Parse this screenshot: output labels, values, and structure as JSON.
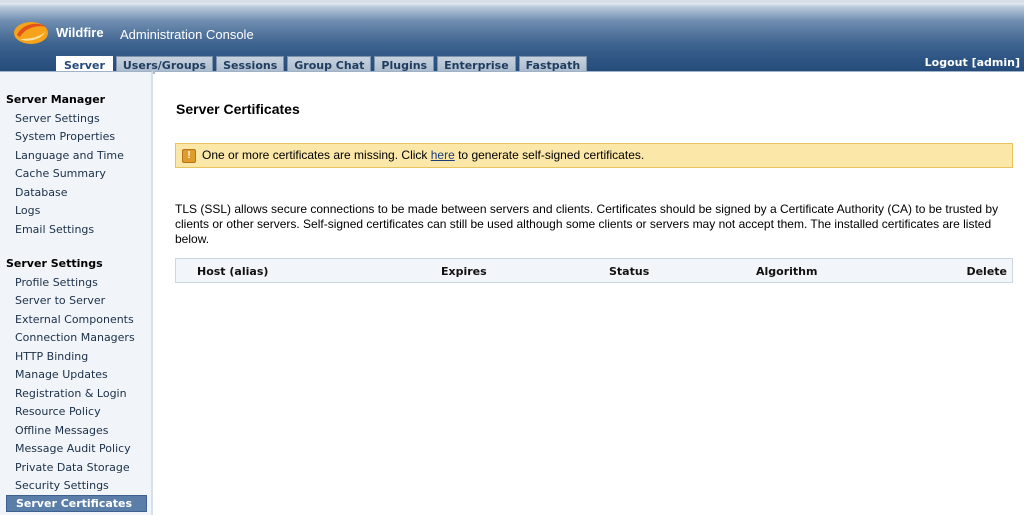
{
  "header": {
    "brand": "Wildfire",
    "title": "Administration Console",
    "logout": "Logout [admin]"
  },
  "tabs": [
    {
      "label": "Server",
      "active": true
    },
    {
      "label": "Users/Groups"
    },
    {
      "label": "Sessions"
    },
    {
      "label": "Group Chat"
    },
    {
      "label": "Plugins"
    },
    {
      "label": "Enterprise"
    },
    {
      "label": "Fastpath"
    }
  ],
  "sidebar": {
    "server_manager": {
      "heading": "Server Manager",
      "items": [
        "Server Settings",
        "System Properties",
        "Language and Time",
        "Cache Summary",
        "Database",
        "Logs",
        "Email Settings"
      ]
    },
    "server_settings": {
      "heading": "Server Settings",
      "items": [
        "Profile Settings",
        "Server to Server",
        "External Components",
        "Connection Managers",
        "HTTP Binding",
        "Manage Updates",
        "Registration & Login",
        "Resource Policy",
        "Offline Messages",
        "Message Audit Policy",
        "Private Data Storage",
        "Security Settings",
        "Server Certificates"
      ],
      "selected": "Server Certificates"
    }
  },
  "main": {
    "title": "Server Certificates",
    "warning": {
      "before": "One or more certificates are missing. Click ",
      "link": "here",
      "after": " to generate self-signed certificates."
    },
    "description": "TLS (SSL) allows secure connections to be made between servers and clients. Certificates should be signed by a Certificate Authority (CA) to be trusted by clients or other servers. Self-signed certificates can still be used although some clients or servers may not accept them. The installed certificates are listed below.",
    "table": {
      "columns": [
        "Host (alias)",
        "Expires",
        "Status",
        "Algorithm",
        "Delete"
      ]
    }
  },
  "colors": {
    "header_dark": "#24497a",
    "sidebar_selected": "#5a7ea7",
    "warning_bg": "#fbe7a8"
  }
}
